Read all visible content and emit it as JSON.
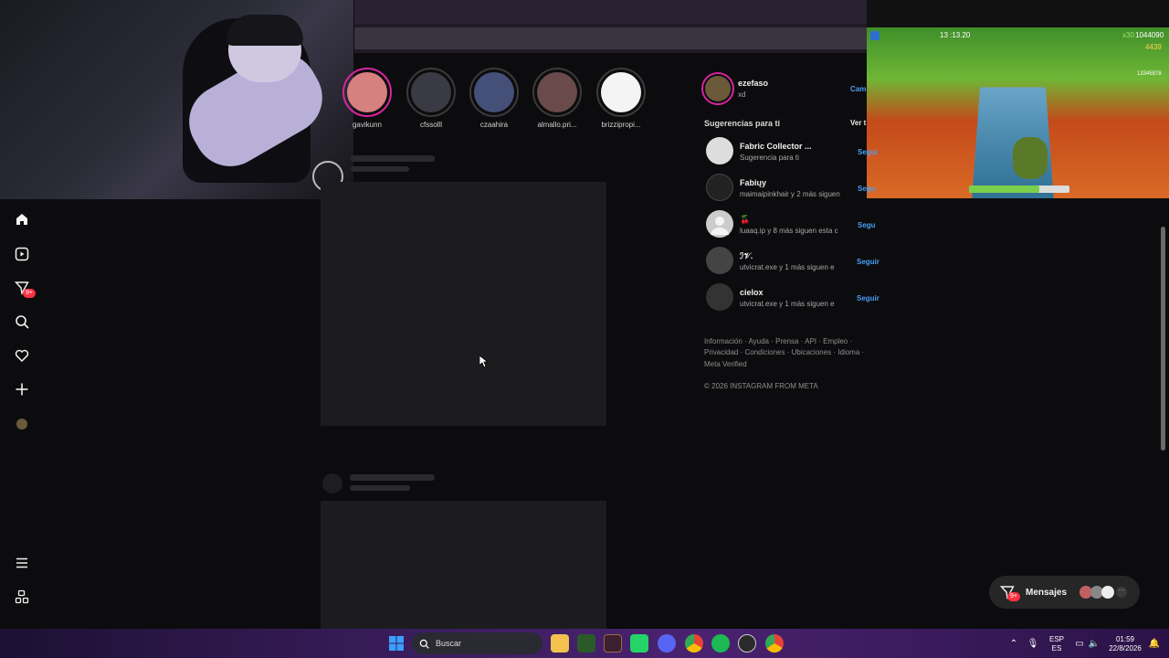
{
  "stories": [
    {
      "label": "gavikunn",
      "active": true,
      "color": "#d68080"
    },
    {
      "label": "cfssolll",
      "active": false,
      "color": "#3a3a44"
    },
    {
      "label": "czaahira",
      "active": false,
      "color": "#445078"
    },
    {
      "label": "almallo.pri...",
      "active": false,
      "color": "#6a4a4a"
    },
    {
      "label": "brizzipropi...",
      "active": false,
      "color": "#f4f4f4"
    }
  ],
  "profile": {
    "username": "ezefaso",
    "fullname": "xd",
    "switch_label": "Cam"
  },
  "suggestions": {
    "heading": "Sugerencias para ti",
    "see_all": "Ver t",
    "items": [
      {
        "name": "Fabric Collector ...",
        "sub": "Sugerencia para ti",
        "follow": "Segui",
        "color": "#dddddd"
      },
      {
        "name": "Fabiųy",
        "sub": "maimaipinkhair y 2 más siguen",
        "follow": "Segu",
        "color": "#222222"
      },
      {
        "name": "🍒",
        "sub": "luaaq.ip y 8 más siguen esta c",
        "follow": "Segu",
        "color": "#cccccc"
      },
      {
        "name": "ℐ𝒱.",
        "sub": "utvicrat.exe y 1 más siguen e",
        "follow": "Seguir",
        "color": "#444444"
      },
      {
        "name": "cielox",
        "sub": "utvicrat.exe y 1 más siguen e",
        "follow": "Seguir",
        "color": "#333333"
      }
    ]
  },
  "footer": {
    "line1": "Información · Ayuda · Prensa · API · Empleo ·",
    "line2": "Privacidad · Condiciones · Ubicaciones · Idioma ·",
    "line3": "Meta Verified",
    "copyright": "© 2026 INSTAGRAM FROM META"
  },
  "nav": {
    "notif_badge": "9+"
  },
  "messages": {
    "label": "Mensajes",
    "badge": "9+"
  },
  "game": {
    "timer": "13 :13.20",
    "score": "1044090",
    "coins": "4439",
    "multiplier": "x30",
    "id": "13345978",
    "jetpack_fill": 0.7
  },
  "taskbar": {
    "search_placeholder": "Buscar",
    "lang_top": "ESP",
    "lang_bottom": "ES",
    "time": "01:59",
    "date": "22/8/2026"
  },
  "colors": {
    "accent": "#4a9ff5",
    "badge": "#ff3040",
    "story_ring": "#d6249f"
  }
}
